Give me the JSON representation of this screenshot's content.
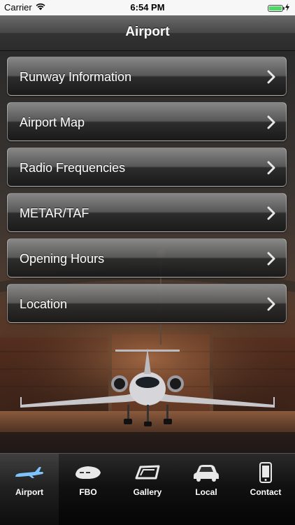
{
  "status_bar": {
    "carrier": "Carrier",
    "time": "6:54 PM"
  },
  "nav": {
    "title": "Airport"
  },
  "menu": [
    {
      "label": "Runway Information"
    },
    {
      "label": "Airport Map"
    },
    {
      "label": "Radio Frequencies"
    },
    {
      "label": "METAR/TAF"
    },
    {
      "label": "Opening Hours"
    },
    {
      "label": "Location"
    }
  ],
  "tabs": [
    {
      "label": "Airport",
      "icon": "plane-icon",
      "active": true
    },
    {
      "label": "FBO",
      "icon": "fbo-building-icon",
      "active": false
    },
    {
      "label": "Gallery",
      "icon": "gallery-icon",
      "active": false
    },
    {
      "label": "Local",
      "icon": "car-icon",
      "active": false
    },
    {
      "label": "Contact",
      "icon": "phone-icon",
      "active": false
    }
  ],
  "colors": {
    "active_tab_icon": "#7fc3ff",
    "battery": "#4cd964"
  }
}
